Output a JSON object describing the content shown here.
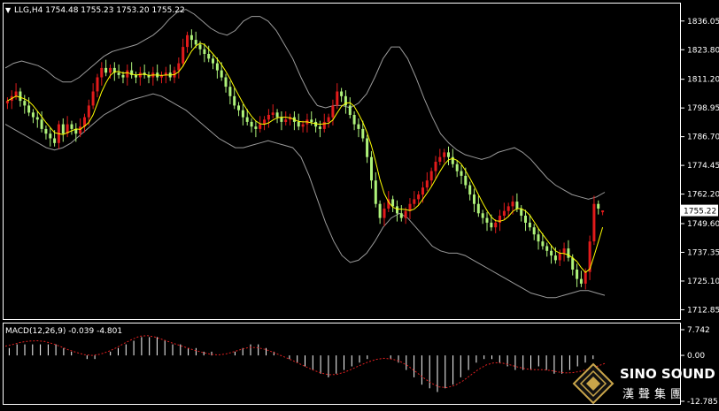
{
  "header": {
    "symbol_info": "LLG,H4  1754.48 1755.23 1753.20 1755.22",
    "macd_info": "MACD(12,26,9) -0.039 -4.801"
  },
  "brand": {
    "name": "SINO SOUND",
    "chinese": "漢聲集團"
  },
  "colors": {
    "background": "#000000",
    "frame": "#ffffff",
    "bull_candle": "#e11b1b",
    "bear_candle": "#aef27a",
    "ma_line": "#ffff00",
    "bands": "#9a9a9a",
    "macd_hist": "#ffffff",
    "macd_signal": "#e02020",
    "price_badge_bg": "#ffffff",
    "price_badge_text": "#000000"
  },
  "chart_data": [
    {
      "type": "candlestick",
      "title": "LLG,H4",
      "last_bar": {
        "open": 1754.48,
        "high": 1755.23,
        "low": 1753.2,
        "close": 1755.22
      },
      "current_price": "1755.22",
      "ylim": [
        1710.0,
        1842.0
      ],
      "y_ticks": [
        "1836.05",
        "1823.80",
        "1811.20",
        "1798.95",
        "1786.70",
        "1774.45",
        "1762.20",
        "1749.60",
        "1737.35",
        "1725.10",
        "1712.85"
      ],
      "y_tick_values": [
        1836.05,
        1823.8,
        1811.2,
        1798.95,
        1786.7,
        1774.45,
        1762.2,
        1749.6,
        1737.35,
        1725.1,
        1712.85
      ],
      "grid": false,
      "overlays": [
        "moving average (yellow)",
        "Bollinger bands (grey)"
      ],
      "close": [
        1802,
        1804,
        1806,
        1802,
        1800,
        1797,
        1795,
        1794,
        1790,
        1788,
        1786,
        1784,
        1792,
        1788,
        1792,
        1790,
        1788,
        1791,
        1795,
        1800,
        1806,
        1812,
        1816,
        1814,
        1816,
        1814,
        1813,
        1812,
        1815,
        1813,
        1812,
        1814,
        1813,
        1812,
        1814,
        1812,
        1813,
        1814,
        1812,
        1815,
        1818,
        1825,
        1830,
        1828,
        1826,
        1824,
        1822,
        1820,
        1818,
        1815,
        1812,
        1808,
        1804,
        1800,
        1798,
        1795,
        1793,
        1791,
        1790,
        1792,
        1794,
        1796,
        1797,
        1795,
        1793,
        1794,
        1795,
        1793,
        1791,
        1792,
        1794,
        1793,
        1791,
        1790,
        1793,
        1795,
        1800,
        1806,
        1804,
        1800,
        1796,
        1792,
        1790,
        1786,
        1778,
        1768,
        1758,
        1752,
        1756,
        1760,
        1757,
        1754,
        1752,
        1755,
        1758,
        1760,
        1762,
        1765,
        1768,
        1772,
        1776,
        1778,
        1780,
        1778,
        1775,
        1772,
        1770,
        1766,
        1762,
        1758,
        1754,
        1752,
        1750,
        1748,
        1750,
        1753,
        1755,
        1757,
        1759,
        1756,
        1753,
        1750,
        1748,
        1745,
        1742,
        1740,
        1738,
        1736,
        1734,
        1737,
        1739,
        1735,
        1730,
        1726,
        1724,
        1729,
        1742,
        1758,
        1756,
        1755.22
      ],
      "bb_upper": [
        1816,
        1818,
        1819,
        1818,
        1817,
        1815,
        1812,
        1810,
        1810,
        1812,
        1815,
        1818,
        1821,
        1823,
        1824,
        1825,
        1826,
        1828,
        1830,
        1833,
        1837,
        1840,
        1841,
        1839,
        1836,
        1833,
        1831,
        1830,
        1832,
        1836,
        1838,
        1838,
        1836,
        1832,
        1826,
        1820,
        1812,
        1805,
        1800,
        1799,
        1800,
        1800,
        1799,
        1801,
        1805,
        1812,
        1820,
        1825,
        1825,
        1820,
        1812,
        1803,
        1795,
        1788,
        1784,
        1781,
        1779,
        1778,
        1777,
        1778,
        1780,
        1781,
        1782,
        1780,
        1777,
        1773,
        1769,
        1766,
        1764,
        1762,
        1761,
        1760,
        1761,
        1763
      ],
      "bb_lower": [
        1792,
        1790,
        1788,
        1786,
        1784,
        1782,
        1781,
        1782,
        1784,
        1787,
        1790,
        1793,
        1796,
        1798,
        1800,
        1802,
        1803,
        1804,
        1805,
        1804,
        1802,
        1800,
        1798,
        1795,
        1792,
        1789,
        1786,
        1784,
        1782,
        1782,
        1783,
        1784,
        1785,
        1784,
        1783,
        1782,
        1778,
        1770,
        1760,
        1750,
        1742,
        1736,
        1733,
        1734,
        1737,
        1742,
        1748,
        1752,
        1754,
        1752,
        1748,
        1744,
        1740,
        1738,
        1737,
        1737,
        1736,
        1734,
        1732,
        1730,
        1728,
        1726,
        1724,
        1722,
        1720,
        1719,
        1718,
        1718,
        1719,
        1720,
        1721,
        1721,
        1720,
        1719
      ]
    },
    {
      "type": "bar",
      "title": "MACD(12,26,9)",
      "main_value": -0.039,
      "signal_value": -4.801,
      "ylim": [
        -12.785,
        7.742
      ],
      "y_ticks": [
        "7.742",
        "0.00",
        "-12.785"
      ],
      "y_tick_values": [
        7.742,
        0,
        -12.785
      ],
      "histogram": [
        2,
        3,
        3,
        3,
        3,
        3,
        3,
        2,
        1,
        0,
        -1,
        -1,
        0,
        1,
        2,
        3,
        4,
        5,
        5,
        5,
        4,
        3,
        3,
        2,
        2,
        1,
        1,
        0,
        0,
        1,
        2,
        3,
        3,
        2,
        1,
        0,
        -1,
        -2,
        -3,
        -4,
        -5,
        -6,
        -5,
        -4,
        -3,
        -2,
        -1,
        0,
        0,
        -1,
        -2,
        -4,
        -6,
        -8,
        -9,
        -10,
        -9,
        -8,
        -6,
        -4,
        -2,
        -1,
        -1,
        -2,
        -3,
        -4,
        -4,
        -4,
        -3,
        -4,
        -5,
        -5,
        -4,
        -3,
        -2,
        -1,
        0
      ],
      "signal": [
        2.5,
        3,
        3.6,
        3.9,
        4.0,
        3.8,
        3.2,
        2.4,
        1.5,
        0.8,
        0.2,
        0,
        0.3,
        1.0,
        2.0,
        3.2,
        4.3,
        5.2,
        5.4,
        5.0,
        4.3,
        3.5,
        2.8,
        2.1,
        1.4,
        0.8,
        0.3,
        0.1,
        0.4,
        1.0,
        1.7,
        2.2,
        2.1,
        1.6,
        0.8,
        -0.1,
        -1.0,
        -2.0,
        -3.0,
        -4.0,
        -4.8,
        -5.3,
        -5.2,
        -4.6,
        -3.7,
        -2.7,
        -1.8,
        -1.1,
        -0.8,
        -1.0,
        -1.6,
        -2.8,
        -4.4,
        -6.1,
        -7.6,
        -8.6,
        -8.8,
        -8.2,
        -7.0,
        -5.4,
        -3.8,
        -2.6,
        -2.0,
        -2.1,
        -2.6,
        -3.2,
        -3.7,
        -3.9,
        -3.9,
        -4.1,
        -4.5,
        -4.8,
        -4.7,
        -4.3,
        -3.7,
        -3.0,
        -2.2
      ]
    }
  ]
}
